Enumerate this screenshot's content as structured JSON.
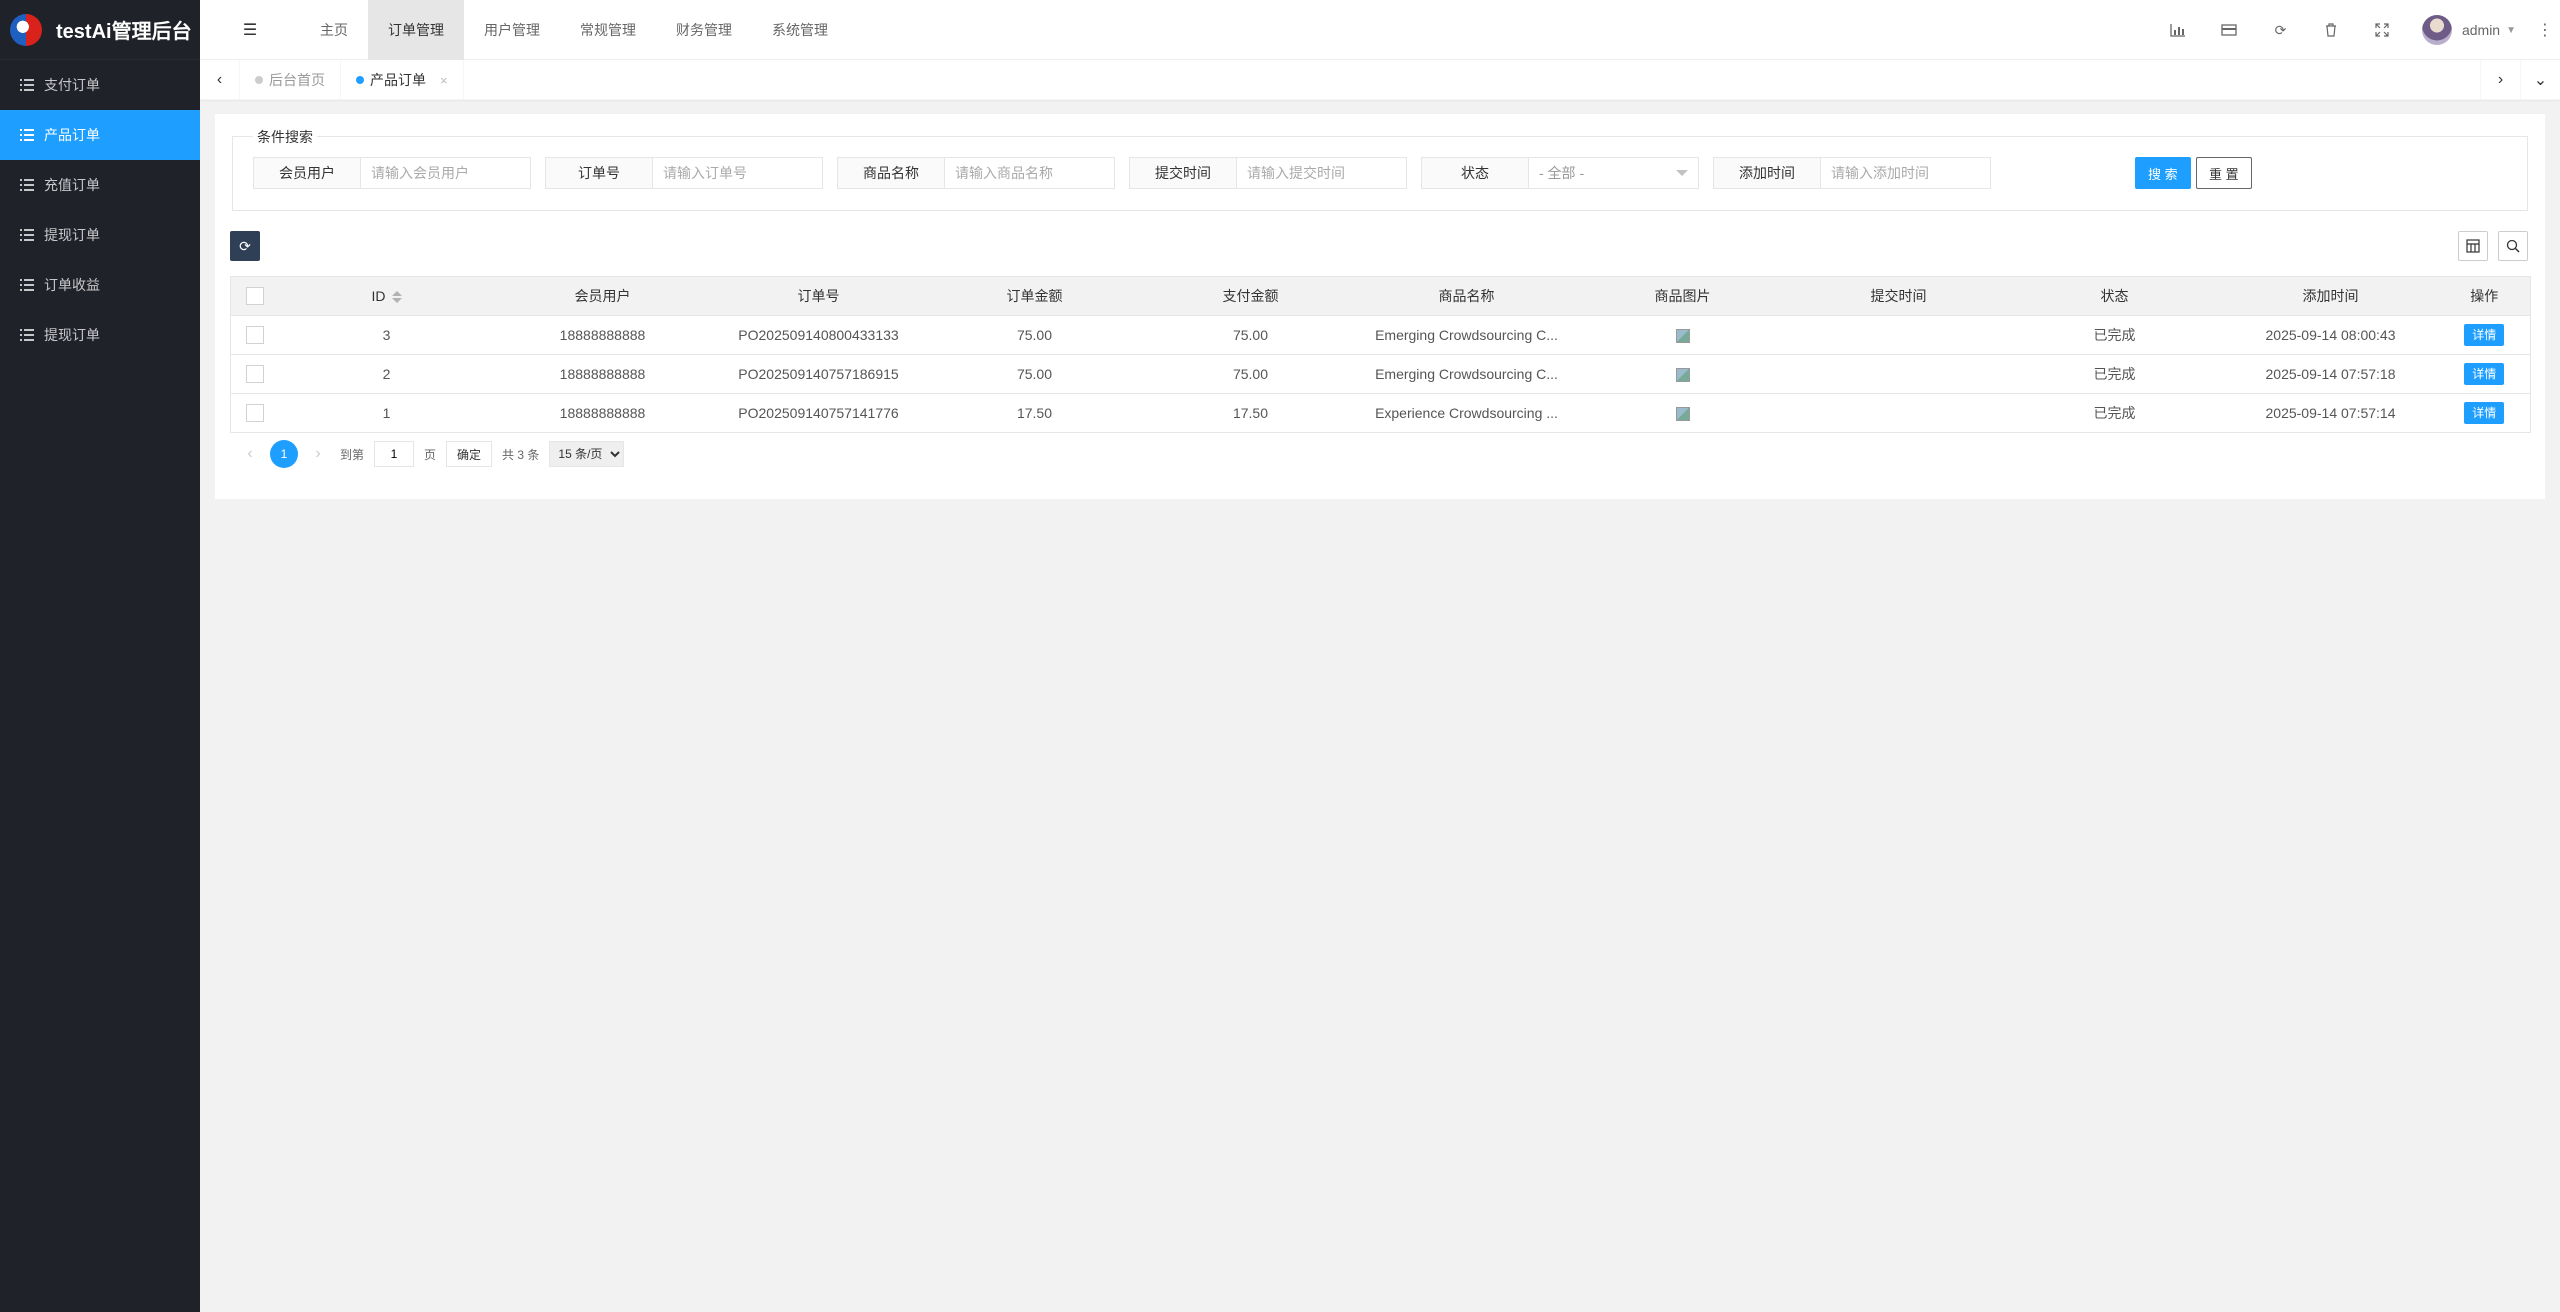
{
  "app": {
    "title": "testAi管理后台"
  },
  "sidebar": {
    "items": [
      {
        "label": "支付订单",
        "active": false
      },
      {
        "label": "产品订单",
        "active": true
      },
      {
        "label": "充值订单",
        "active": false
      },
      {
        "label": "提现订单",
        "active": false
      },
      {
        "label": "订单收益",
        "active": false
      },
      {
        "label": "提现订单",
        "active": false
      }
    ]
  },
  "topnav": {
    "items": [
      {
        "label": "主页"
      },
      {
        "label": "订单管理"
      },
      {
        "label": "用户管理"
      },
      {
        "label": "常规管理"
      },
      {
        "label": "财务管理"
      },
      {
        "label": "系统管理"
      }
    ],
    "active_index": 1
  },
  "header": {
    "username": "admin"
  },
  "tabs": [
    {
      "label": "后台首页"
    },
    {
      "label": "产品订单",
      "close": "×"
    }
  ],
  "search": {
    "legend": "条件搜索",
    "fields": [
      {
        "label": "会员用户",
        "placeholder": "请输入会员用户"
      },
      {
        "label": "订单号",
        "placeholder": "请输入订单号"
      },
      {
        "label": "商品名称",
        "placeholder": "请输入商品名称"
      },
      {
        "label": "提交时间",
        "placeholder": "请输入提交时间"
      },
      {
        "label": "状态",
        "selected": "- 全部 -"
      },
      {
        "label": "添加时间",
        "placeholder": "请输入添加时间"
      }
    ],
    "search_btn": "搜 索",
    "reset_btn": "重 置"
  },
  "table": {
    "columns": [
      "ID",
      "会员用户",
      "订单号",
      "订单金额",
      "支付金额",
      "商品名称",
      "商品图片",
      "提交时间",
      "状态",
      "添加时间",
      "操作"
    ],
    "rows": [
      {
        "id": "3",
        "user": "18888888888",
        "order_no": "PO202509140800433133",
        "order_amount": "75.00",
        "pay_amount": "75.00",
        "product": "Emerging Crowdsourcing C...",
        "submit_time": "",
        "status": "已完成",
        "add_time": "2025-09-14 08:00:43",
        "action": "详情"
      },
      {
        "id": "2",
        "user": "18888888888",
        "order_no": "PO202509140757186915",
        "order_amount": "75.00",
        "pay_amount": "75.00",
        "product": "Emerging Crowdsourcing C...",
        "submit_time": "",
        "status": "已完成",
        "add_time": "2025-09-14 07:57:18",
        "action": "详情"
      },
      {
        "id": "1",
        "user": "18888888888",
        "order_no": "PO202509140757141776",
        "order_amount": "17.50",
        "pay_amount": "17.50",
        "product": "Experience Crowdsourcing ...",
        "submit_time": "",
        "status": "已完成",
        "add_time": "2025-09-14 07:57:14",
        "action": "详情"
      }
    ]
  },
  "pager": {
    "current": "1",
    "goto_label": "到第",
    "goto_value": "1",
    "page_unit": "页",
    "ok": "确定",
    "count": "共 3 条",
    "limit": "15 条/页"
  },
  "colors": {
    "accent": "#1e9fff",
    "sidebar_bg": "#20222a",
    "dark_btn": "#2f4056"
  }
}
